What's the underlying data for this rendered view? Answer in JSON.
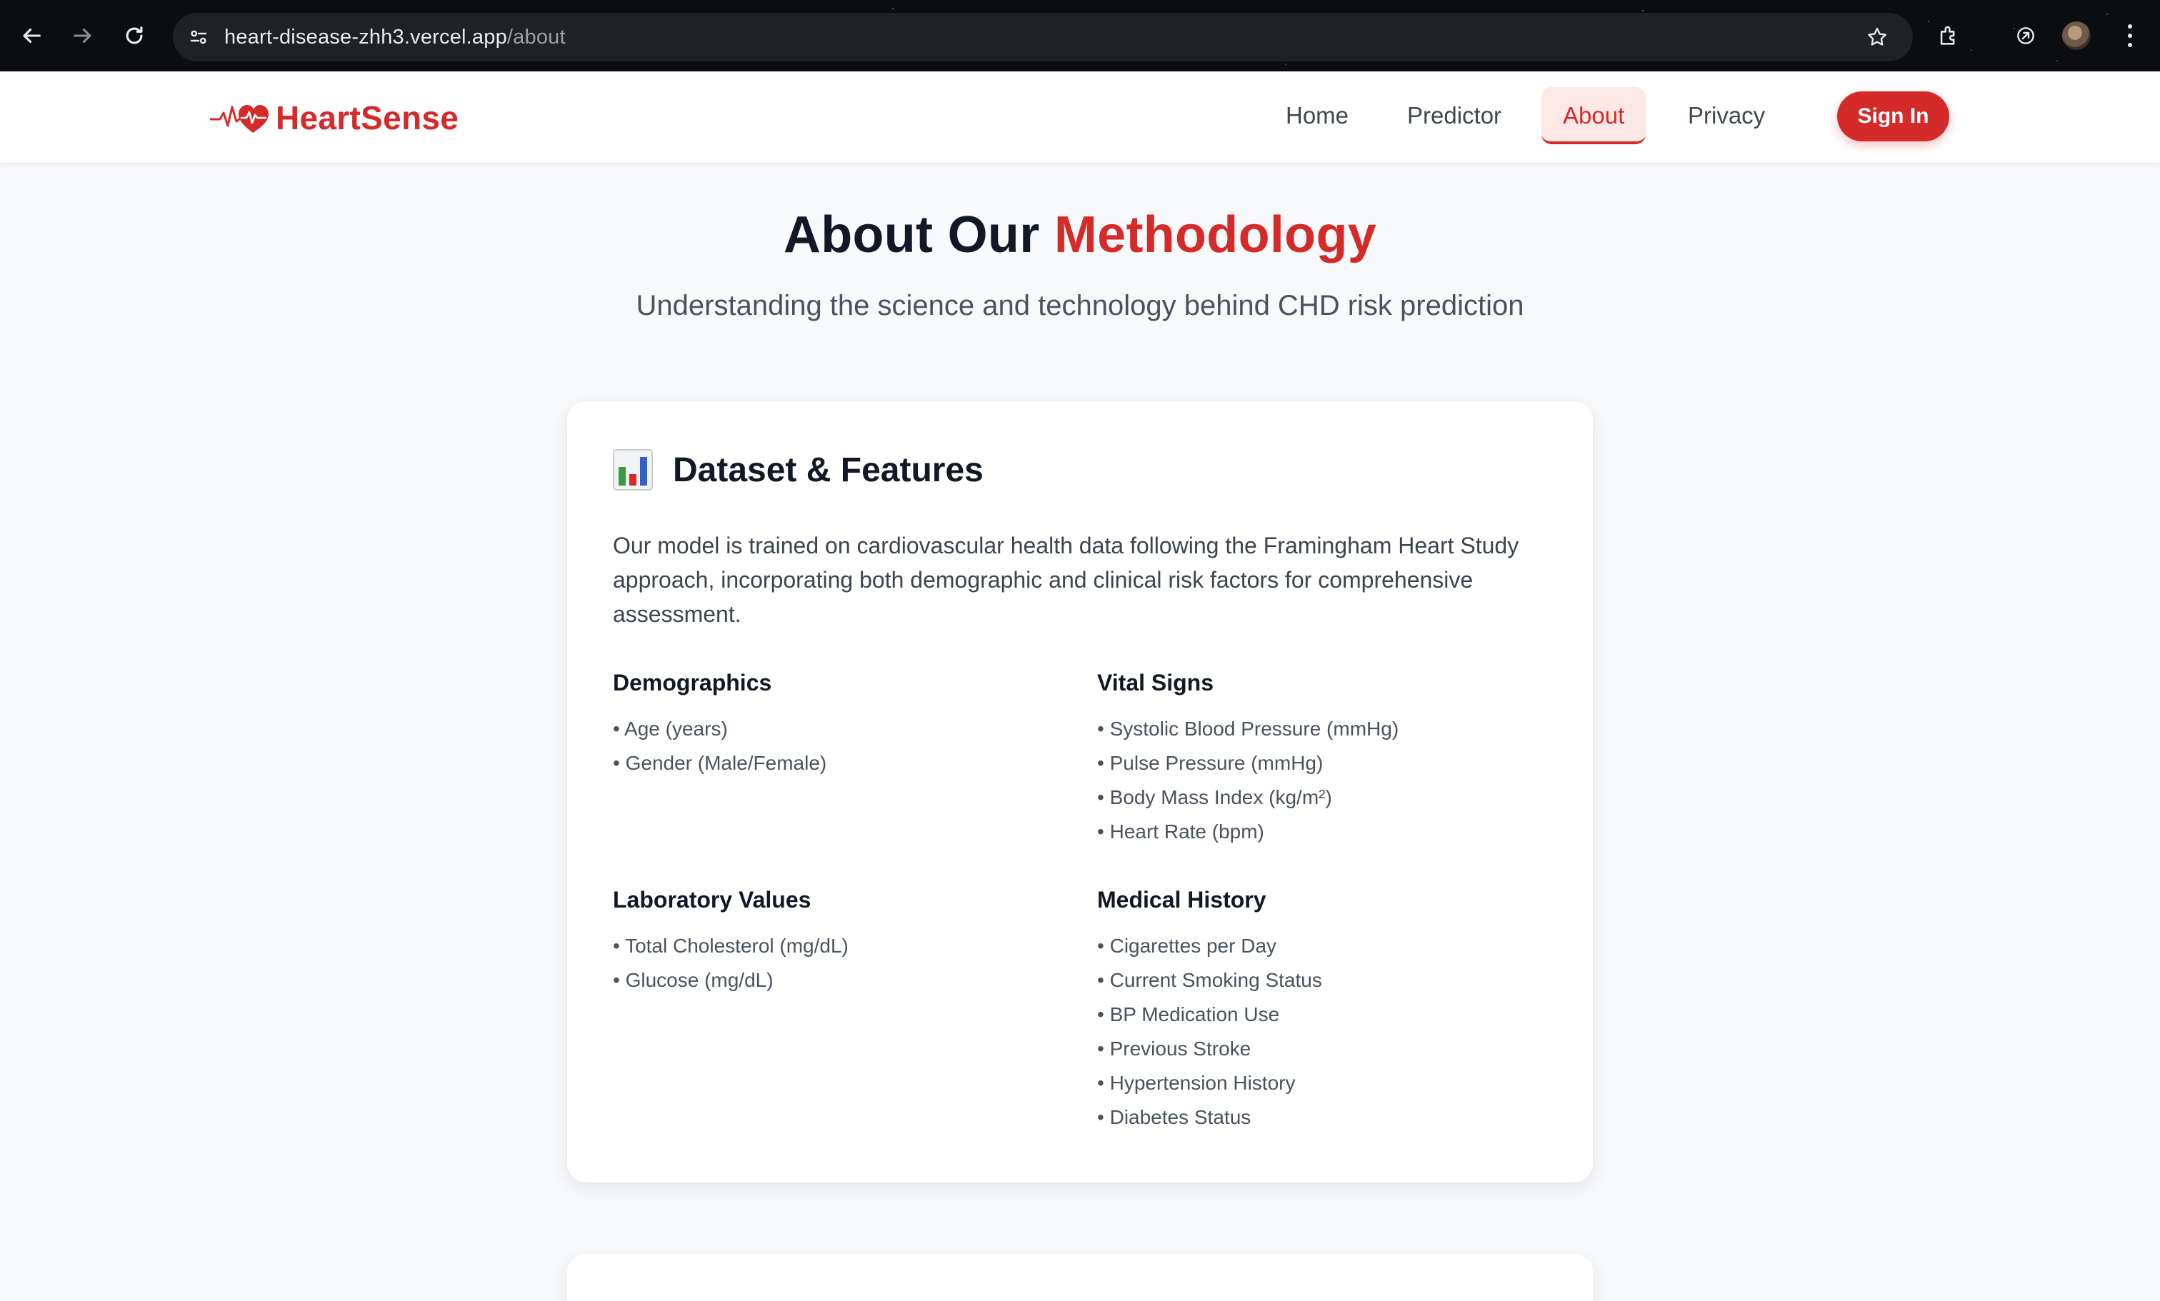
{
  "browser": {
    "url_host": "heart-disease-zhh3.vercel.app",
    "url_path": "/about",
    "icons": [
      "back-arrow-icon",
      "forward-arrow-icon",
      "reload-icon",
      "site-info-icon",
      "star-icon",
      "extensions-icon",
      "sync-icon",
      "profile-avatar",
      "menu-dots-icon"
    ]
  },
  "header": {
    "brand": "HeartSense",
    "brand_icon": "heartbeat-icon",
    "nav": [
      {
        "label": "Home"
      },
      {
        "label": "Predictor"
      },
      {
        "label": "About",
        "active": true
      },
      {
        "label": "Privacy"
      }
    ],
    "signin_label": "Sign In"
  },
  "hero": {
    "title_part1": "About Our",
    "title_accent": "Methodology",
    "subtitle": "Understanding the science and technology behind CHD risk prediction"
  },
  "card": {
    "icon": "bar-chart-icon",
    "title": "Dataset & Features",
    "description": "Our model is trained on cardiovascular health data following the Framingham Heart Study approach, incorporating both demographic and clinical risk factors for comprehensive assessment.",
    "groups": [
      {
        "title": "Demographics",
        "items": [
          "Age (years)",
          "Gender (Male/Female)"
        ]
      },
      {
        "title": "Vital Signs",
        "items": [
          "Systolic Blood Pressure (mmHg)",
          "Pulse Pressure (mmHg)",
          "Body Mass Index (kg/m²)",
          "Heart Rate (bpm)"
        ]
      },
      {
        "title": "Laboratory Values",
        "items": [
          "Total Cholesterol (mg/dL)",
          "Glucose (mg/dL)"
        ]
      },
      {
        "title": "Medical History",
        "items": [
          "Cigarettes per Day",
          "Current Smoking Status",
          "BP Medication Use",
          "Previous Stroke",
          "Hypertension History",
          "Diabetes Status"
        ]
      }
    ]
  },
  "colors": {
    "brand_red": "#d42a2a",
    "heading": "#121826",
    "body_text": "#3c4450",
    "page_bg": "#f8f9fb"
  }
}
